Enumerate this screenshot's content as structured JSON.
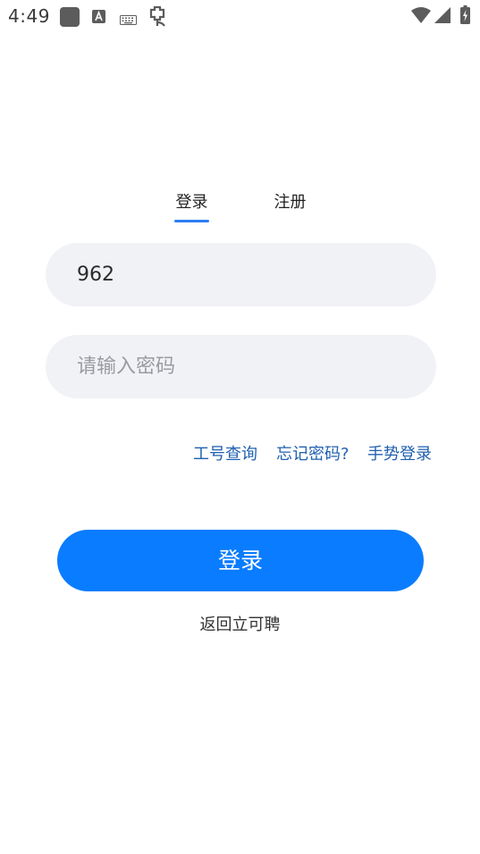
{
  "status_bar": {
    "time": "4:49",
    "icons": [
      "app-square-icon",
      "font-a-icon",
      "keyboard-icon",
      "bug-icon",
      "wifi-icon",
      "signal-icon",
      "battery-charging-icon"
    ]
  },
  "tabs": [
    {
      "label": "登录",
      "selected": true
    },
    {
      "label": "注册",
      "selected": false
    }
  ],
  "form": {
    "username_value": "962",
    "password_placeholder": "请输入密码"
  },
  "links": {
    "employee_lookup": "工号查询",
    "forgot_password": "忘记密码?",
    "gesture_login": "手势登录"
  },
  "login_button_label": "登录",
  "back_link": "返回立可聘",
  "colors": {
    "accent": "#0a7cff",
    "tab_underline": "#2f7df6",
    "link": "#1f5fb0",
    "field_bg": "#f1f2f6"
  }
}
